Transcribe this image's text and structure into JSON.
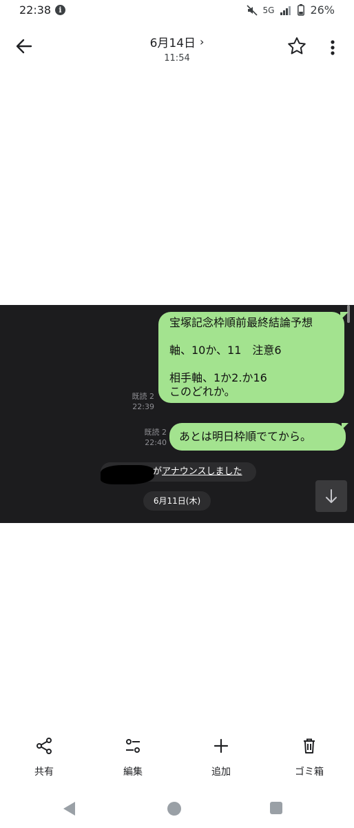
{
  "status_bar": {
    "time": "22:38",
    "info_glyph": "i",
    "network": "5G",
    "battery": "26%"
  },
  "app_bar": {
    "title": "6月14日",
    "chevron": "›",
    "subtitle": "11:54"
  },
  "chat": {
    "message1": {
      "lines": [
        "宝塚記念枠順前最終結論予想",
        "",
        "軸、10か、11　注意6",
        "",
        "相手軸、1か2.か16",
        "このどれか。"
      ],
      "read_label": "既読 2",
      "time": "22:39"
    },
    "message2": {
      "text": "あとは明日枠順でてから。",
      "read_label": "既読 2",
      "time": "22:40"
    },
    "announcement": {
      "prefix": "が",
      "link": "アナウンスしました"
    },
    "date_divider": "6月11日(木)"
  },
  "actions": [
    {
      "label": "共有",
      "icon": "share-icon"
    },
    {
      "label": "編集",
      "icon": "edit-sliders-icon"
    },
    {
      "label": "追加",
      "icon": "plus-icon"
    },
    {
      "label": "ゴミ箱",
      "icon": "trash-icon"
    }
  ],
  "colors": {
    "bubble": "#a3e38f",
    "chat_bg": "#1c1c1e"
  }
}
